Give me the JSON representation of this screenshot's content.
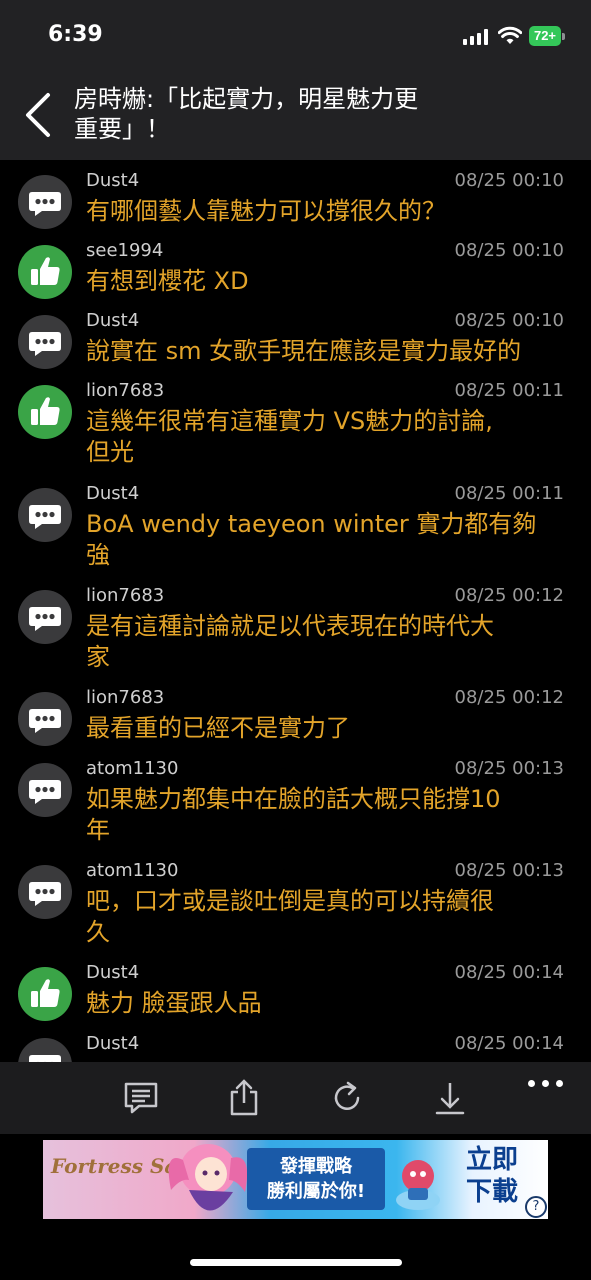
{
  "status_bar": {
    "time": "6:39",
    "battery": "72+"
  },
  "header": {
    "title_line1": "房時爀:「比起實力，明星魅力更",
    "title_line2": "重要」！"
  },
  "comments": [
    {
      "avatar": "chat",
      "user": "Dust4",
      "time": "08/25 00:10",
      "lines": [
        "有哪個藝人靠魅力可以撐很久的？"
      ]
    },
    {
      "avatar": "like",
      "user": "see1994",
      "time": "08/25 00:10",
      "lines": [
        "有想到櫻花 XD"
      ]
    },
    {
      "avatar": "chat",
      "user": "Dust4",
      "time": "08/25 00:10",
      "lines": [
        "說實在 sm 女歌手現在應該是實力最好的"
      ]
    },
    {
      "avatar": "like",
      "user": "lion7683",
      "time": "08/25 00:11",
      "lines": [
        "這幾年很常有這種實力 VS魅力的討論,",
        "但光"
      ]
    },
    {
      "avatar": "chat",
      "user": "Dust4",
      "time": "08/25 00:11",
      "lines": [
        "BoA wendy taeyeon winter 實力都有夠",
        "強"
      ]
    },
    {
      "avatar": "chat",
      "user": "lion7683",
      "time": "08/25 00:12",
      "lines": [
        "是有這種討論就足以代表現在的時代大",
        "家"
      ]
    },
    {
      "avatar": "chat",
      "user": "lion7683",
      "time": "08/25 00:12",
      "lines": [
        "最看重的已經不是實力了"
      ]
    },
    {
      "avatar": "chat",
      "user": "atom1130",
      "time": "08/25 00:13",
      "lines": [
        "如果魅力都集中在臉的話大概只能撐10",
        "年"
      ]
    },
    {
      "avatar": "chat",
      "user": "atom1130",
      "time": "08/25 00:13",
      "lines": [
        "吧，口才或是談吐倒是真的可以持續很",
        "久"
      ]
    },
    {
      "avatar": "like",
      "user": "Dust4",
      "time": "08/25 00:14",
      "lines": [
        "魅力 臉蛋跟人品"
      ]
    },
    {
      "avatar": "chat",
      "user": "Dust4",
      "time": "08/25 00:14",
      "lines": [
        ""
      ]
    }
  ],
  "toolbar": {
    "icons": [
      "comment-icon",
      "share-icon",
      "refresh-icon",
      "download-icon",
      "more-icon"
    ]
  },
  "ad": {
    "logo": "Fortress Saga",
    "slogan_line1": "發揮戰略",
    "slogan_line2": "勝利屬於你!",
    "cta_line1": "立即",
    "cta_line2": "下載",
    "help": "?"
  },
  "colors": {
    "comment_text": "#e3a42a",
    "like_avatar": "#3aa447",
    "chat_avatar": "#3a3a3c",
    "header_bg": "#222224"
  }
}
